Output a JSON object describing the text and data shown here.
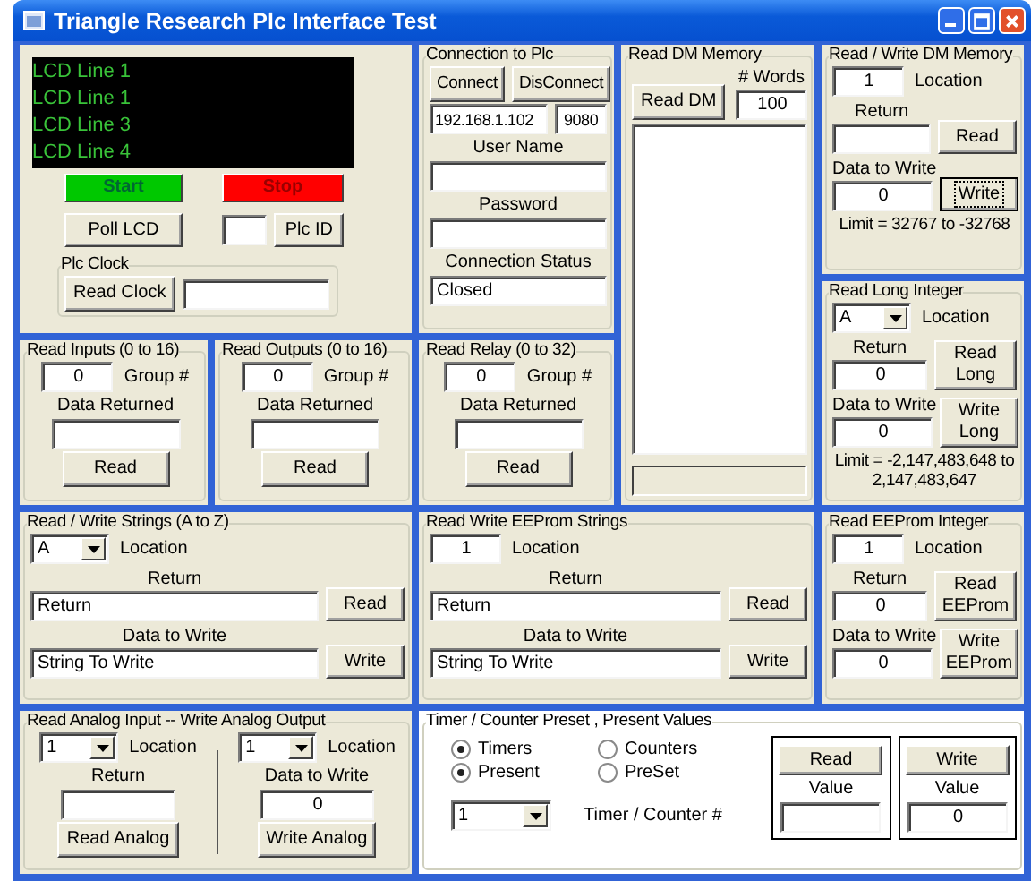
{
  "window": {
    "title": "Triangle Research Plc Interface Test"
  },
  "lcd": {
    "lines": [
      "LCD Line 1",
      "LCD Line 1",
      "LCD Line 3",
      "LCD Line 4"
    ],
    "start_button": "Start",
    "stop_button": "Stop",
    "poll_button": "Poll LCD",
    "plc_id_button": "Plc ID",
    "clock": {
      "title": "Plc Clock",
      "read_button": "Read Clock"
    }
  },
  "connection": {
    "title": "Connection to Plc",
    "connect_button": "Connect",
    "disconnect_button": "DisConnect",
    "ip": "192.168.1.102",
    "port": "9080",
    "user_label": "User Name",
    "password_label": "Password",
    "status_label": "Connection Status",
    "status": "Closed"
  },
  "read_dm": {
    "title": "Read DM Memory",
    "read_button": "Read DM",
    "words_label": "# Words",
    "words": "100"
  },
  "rw_dm": {
    "title": "Read / Write DM Memory",
    "location": {
      "kind": "text",
      "value": "1"
    },
    "location_label": "Location",
    "return_label": "Return",
    "read_button": {
      "label": "Read",
      "focused": false
    },
    "data_label": "Data to Write",
    "data": "0",
    "write_button": {
      "label": "Write",
      "focused": true
    },
    "limit": "Limit = 32767 to -32768"
  },
  "read_long": {
    "title": "Read Long Integer",
    "location": {
      "kind": "combo",
      "value": "A"
    },
    "location_label": "Location",
    "return_label": "Return",
    "return": "0",
    "read_button": {
      "label": "Read Long",
      "focused": false
    },
    "data_label": "Data to Write",
    "data": "0",
    "write_button": {
      "label": "Write Long",
      "focused": false
    },
    "limit": "Limit = -2,147,483,648 to 2,147,483,647"
  },
  "bit_groups": [
    {
      "title": "Read Inputs (0 to 16)",
      "group": "0",
      "group_label": "Group #",
      "returned_label": "Data Returned",
      "read_button": "Read"
    },
    {
      "title": "Read Outputs (0 to 16)",
      "group": "0",
      "group_label": "Group #",
      "returned_label": "Data Returned",
      "read_button": "Read"
    },
    {
      "title": "Read Relay (0 to 32)",
      "group": "0",
      "group_label": "Group #",
      "returned_label": "Data Returned",
      "read_button": "Read"
    }
  ],
  "strings": {
    "title": "Read / Write Strings (A to Z)",
    "location": {
      "kind": "combo",
      "value": "A"
    },
    "location_label": "Location",
    "return_label": "Return",
    "return": "Return",
    "read_button": {
      "label": "Read",
      "focused": false
    },
    "data_label": "Data to Write",
    "data": "String To Write",
    "write_button": {
      "label": "Write",
      "focused": false
    }
  },
  "ee_strings": {
    "title": "Read Write EEProm Strings",
    "location": {
      "kind": "text",
      "value": "1"
    },
    "location_label": "Location",
    "return_label": "Return",
    "return": "Return",
    "read_button": {
      "label": "Read",
      "focused": false
    },
    "data_label": "Data to Write",
    "data": "String To Write",
    "write_button": {
      "label": "Write",
      "focused": false
    }
  },
  "ee_int": {
    "title": "Read EEProm Integer",
    "location": {
      "kind": "text",
      "value": "1"
    },
    "location_label": "Location",
    "return_label": "Return",
    "return": "0",
    "read_button": {
      "label": "Read EEProm",
      "focused": false
    },
    "data_label": "Data to Write",
    "data": "0",
    "write_button": {
      "label": "Write EEProm",
      "focused": false
    }
  },
  "analog": {
    "title": "Read Analog Input -- Write Analog Output",
    "input": {
      "location": "1",
      "location_label": "Location",
      "return_label": "Return",
      "button": "Read Analog"
    },
    "output": {
      "location": "1",
      "location_label": "Location",
      "data_label": "Data to Write",
      "data": "0",
      "button": "Write Analog"
    }
  },
  "timer": {
    "title": "Timer / Counter Preset , Present Values",
    "type_options": [
      {
        "label": "Timers",
        "selected": true
      },
      {
        "label": "Counters",
        "selected": false
      }
    ],
    "value_options": [
      {
        "label": "Present",
        "selected": true
      },
      {
        "label": "PreSet",
        "selected": false
      }
    ],
    "number": "1",
    "number_label": "Timer / Counter #",
    "read_box": {
      "button": "Read",
      "value_label": "Value"
    },
    "write_box": {
      "button": "Write",
      "value_label": "Value",
      "value": "0"
    }
  }
}
